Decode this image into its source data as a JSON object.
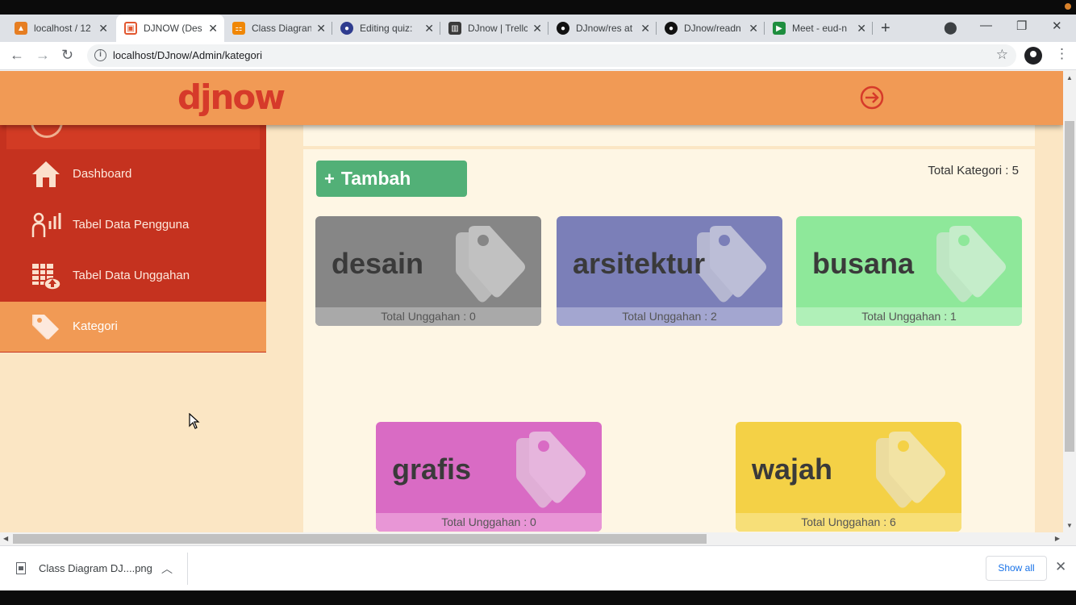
{
  "browser": {
    "tabs": [
      {
        "title": "localhost / 12",
        "favicon": "phpmyadmin-icon",
        "color": "#e67e22"
      },
      {
        "title": "DJNOW (Des",
        "favicon": "djnow-favicon",
        "color": "#e2572f"
      },
      {
        "title": "Class Diagran",
        "favicon": "drawio-icon",
        "color": "#f08705"
      },
      {
        "title": "Editing quiz:",
        "favicon": "quiz-icon",
        "color": "#2f3c8f"
      },
      {
        "title": "DJnow | Trellc",
        "favicon": "trello-icon",
        "color": "#3a3a3a"
      },
      {
        "title": "DJnow/res at",
        "favicon": "github-icon",
        "color": "#111111"
      },
      {
        "title": "DJnow/readn",
        "favicon": "github-icon",
        "color": "#111111"
      },
      {
        "title": "Meet - eud-n",
        "favicon": "meet-icon",
        "color": "#1e8e3e"
      }
    ],
    "url": "localhost/DJnow/Admin/kategori"
  },
  "header": {
    "logo": "djnow"
  },
  "sidebar": {
    "items": [
      {
        "label": "Dashboard",
        "icon": "home-icon"
      },
      {
        "label": "Tabel Data Pengguna",
        "icon": "user-stats-icon"
      },
      {
        "label": "Tabel Data Unggahan",
        "icon": "upload-table-icon"
      },
      {
        "label": "Kategori",
        "icon": "tag-icon"
      }
    ]
  },
  "main": {
    "add_button": "Tambah",
    "total_label": "Total Kategori : 5",
    "categories": [
      {
        "name": "desain",
        "footer": "Total Unggahan : 0",
        "color": "#868686",
        "foot_color": "#a9a9a9"
      },
      {
        "name": "arsitektur",
        "footer": "Total Unggahan : 2",
        "color": "#7b7fb8",
        "foot_color": "#a3a6d0"
      },
      {
        "name": "busana",
        "footer": "Total Unggahan : 1",
        "color": "#8ee89a",
        "foot_color": "#b0f0b8"
      },
      {
        "name": "grafis",
        "footer": "Total Unggahan : 0",
        "color": "#d96bc4",
        "foot_color": "#e896d6"
      },
      {
        "name": "wajah",
        "footer": "Total Unggahan : 6",
        "color": "#f4d146",
        "foot_color": "#f7df78"
      }
    ]
  },
  "downloads": {
    "file": "Class Diagram DJ....png",
    "show_all": "Show all"
  }
}
